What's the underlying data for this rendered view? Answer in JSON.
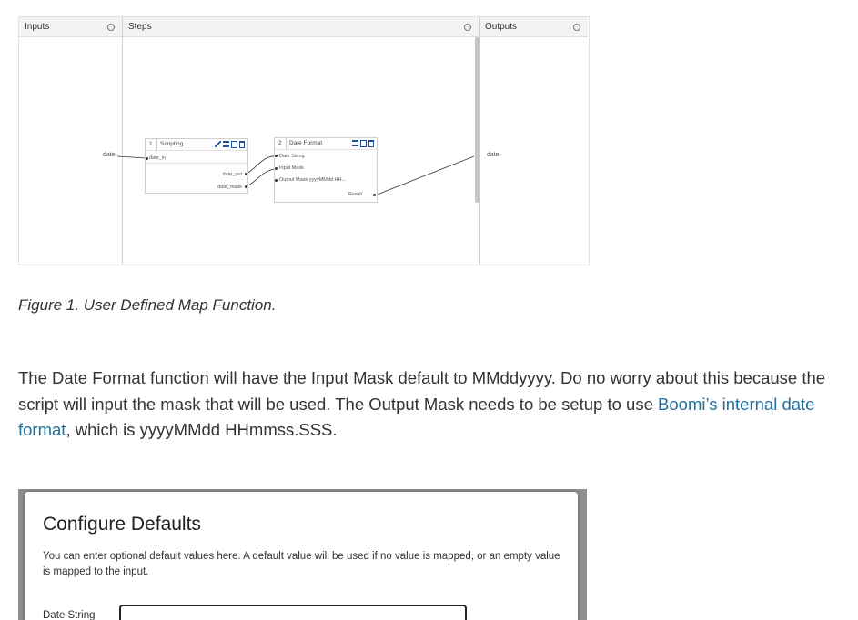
{
  "figure1": {
    "panels": {
      "inputs": "Inputs",
      "steps": "Steps",
      "outputs": "Outputs"
    },
    "input_field": "date",
    "output_field": "date",
    "step1": {
      "number": "1",
      "name": "Scripting",
      "input": "date_in",
      "outputs": [
        "date_out",
        "date_mask"
      ]
    },
    "step2": {
      "number": "2",
      "name": "Date Format",
      "inputs": [
        "Date String",
        "Input Mask",
        "Output Mask yyyyMMdd HH..."
      ],
      "output": "Result"
    }
  },
  "caption": "Figure 1. User Defined Map Function.",
  "paragraph": {
    "before_link": "The Date Format function will have the Input Mask default to MMddyyyy. Do no worry about this because the script will input the mask that will be used. The Output Mask needs to be setup to use ",
    "link": "Boomi’s internal date format",
    "after_link": ", which is yyyyMMdd HHmmss.SSS."
  },
  "dialog": {
    "title": "Configure Defaults",
    "description": "You can enter optional default values here. A default value will be used if no value is mapped, or an empty value is mapped to the input.",
    "field_label": "Date String",
    "field_value": ""
  },
  "colors": {
    "link": "#1f6f9f",
    "icon_blue": "#1f4fa0",
    "overlay": "#8f8f8f"
  }
}
